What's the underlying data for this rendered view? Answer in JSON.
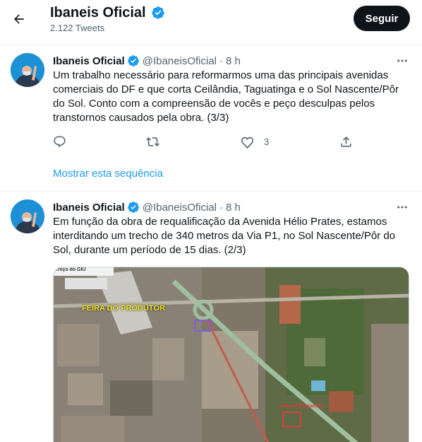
{
  "header": {
    "profile_name": "Ibaneis Oficial",
    "tweet_count": "2.122 Tweets",
    "follow_label": "Seguir"
  },
  "tweets": [
    {
      "author": "Ibaneis Oficial",
      "handle": "@IbaneisOficial",
      "separator": "·",
      "time": "8 h",
      "text": "Um trabalho necessário para reformarmos uma das principais avenidas comerciais do DF e que corta Ceilândia, Taguatinga e o Sol Nascente/Pôr do Sol. Conto com a compreensão de vocês e peço desculpas pelos transtornos causados pela obra. (3/3)",
      "likes": "3",
      "show_thread": "Mostrar esta sequência"
    },
    {
      "author": "Ibaneis Oficial",
      "handle": "@IbaneisOficial",
      "separator": "·",
      "time": "8 h",
      "text": "Em função da obra de requalificação da Avenida Hélio Prates, estamos interditando um trecho de 340 metros da Via P1, no Sol Nascente/Pôr do Sol, durante um período de 15 dias. (2/3)",
      "media": {
        "map_search_text": "ereço do GIU",
        "label_main": "FEIRA DO PRODUTOR",
        "label_red": "Acesso Bloqueado"
      }
    }
  ],
  "colors": {
    "accent": "#1d9bf0",
    "text": "#0f1419",
    "secondary": "#536471",
    "follow_bg": "#0f1419"
  },
  "icons": [
    "back-arrow-icon",
    "verified-badge-icon",
    "more-icon",
    "reply-icon",
    "retweet-icon",
    "like-icon",
    "share-icon"
  ]
}
